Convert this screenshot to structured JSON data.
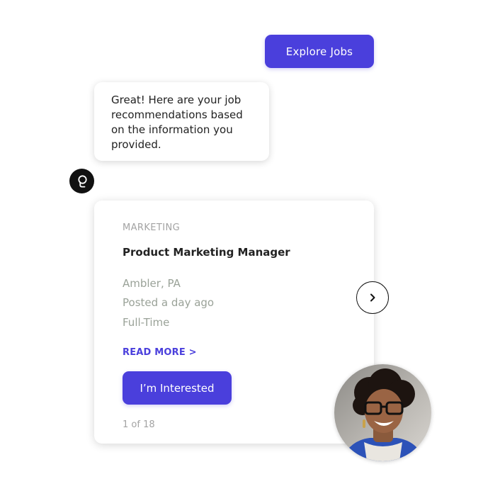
{
  "chat": {
    "explore_button": "Explore Jobs",
    "bot_message": "Great! Here are your job recommendations based on the information you provided."
  },
  "job_card": {
    "category": "MARKETING",
    "title": "Product Marketing Manager",
    "location": "Ambler, PA",
    "posted": "Posted a day ago",
    "employment_type": "Full-Time",
    "read_more": "READ MORE >",
    "interested_button": "I’m Interested",
    "pager": "1 of 18"
  },
  "icons": {
    "bot_avatar": "bot-logo-icon",
    "next": "chevron-right-icon",
    "user": "user-photo-avatar"
  },
  "colors": {
    "accent": "#4a3fdc",
    "muted_text": "#9aa298",
    "label_text": "#a3a3a3"
  }
}
